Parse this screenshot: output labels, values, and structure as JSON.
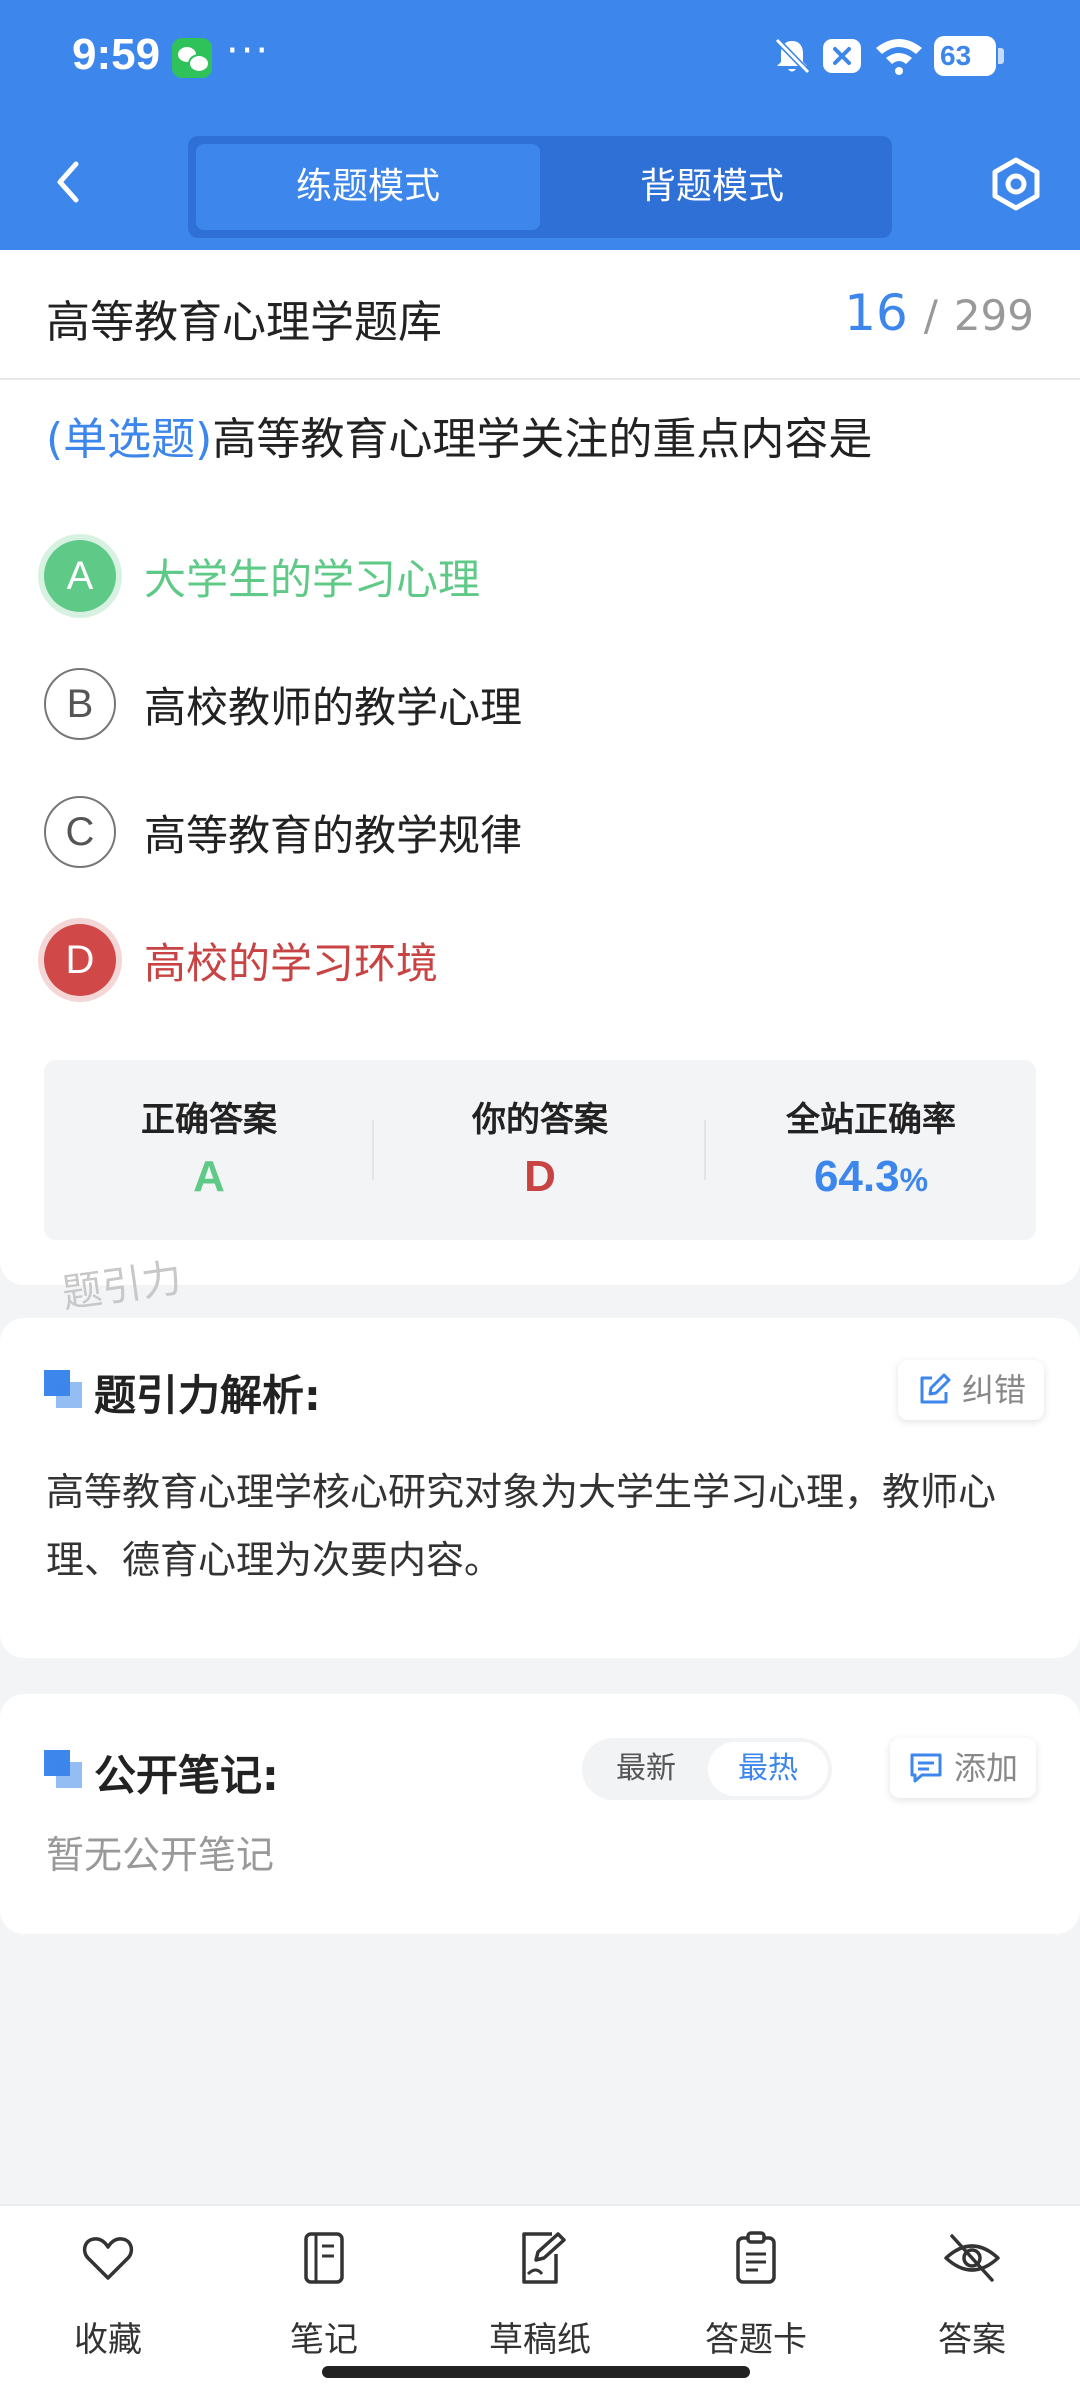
{
  "status_bar": {
    "time": "9:59",
    "dots": "···",
    "battery": "63",
    "icons": [
      "wechat-icon",
      "bell-off-icon",
      "close-badge-icon",
      "wifi-icon",
      "battery-icon"
    ]
  },
  "nav": {
    "modes": [
      {
        "label": "练题模式",
        "active": true
      },
      {
        "label": "背题模式",
        "active": false
      }
    ]
  },
  "question_bank": {
    "title": "高等教育心理学题库",
    "current": "16",
    "separator": "/",
    "total": "299"
  },
  "question": {
    "type": "(单选题)",
    "text": "高等教育心理学关注的重点内容是",
    "options": [
      {
        "letter": "A",
        "text": "大学生的学习心理",
        "state": "correct"
      },
      {
        "letter": "B",
        "text": "高校教师的教学心理",
        "state": "normal"
      },
      {
        "letter": "C",
        "text": "高等教育的教学规律",
        "state": "normal"
      },
      {
        "letter": "D",
        "text": "高校的学习环境",
        "state": "wrong"
      }
    ]
  },
  "answer_summary": {
    "correct_label": "正确答案",
    "correct_value": "A",
    "yours_label": "你的答案",
    "yours_value": "D",
    "rate_label": "全站正确率",
    "rate_value": "64.3",
    "rate_unit": "%"
  },
  "watermark": "题引力",
  "analysis": {
    "title": "题引力解析:",
    "report_button": "纠错",
    "text": "高等教育心理学核心研究对象为大学生学习心理，教师心理、德育心理为次要内容。"
  },
  "notes": {
    "title": "公开笔记:",
    "sort_latest": "最新",
    "sort_hottest": "最热",
    "add_button": "添加",
    "empty_text": "暂无公开笔记"
  },
  "bottom_tabs": [
    {
      "label": "收藏",
      "icon": "heart-icon"
    },
    {
      "label": "笔记",
      "icon": "notebook-icon"
    },
    {
      "label": "草稿纸",
      "icon": "draft-paper-icon"
    },
    {
      "label": "答题卡",
      "icon": "answer-sheet-icon"
    },
    {
      "label": "答案",
      "icon": "eye-off-icon"
    }
  ],
  "colors": {
    "primary": "#3d86eb",
    "correct": "#5fc987",
    "wrong": "#d04848"
  }
}
